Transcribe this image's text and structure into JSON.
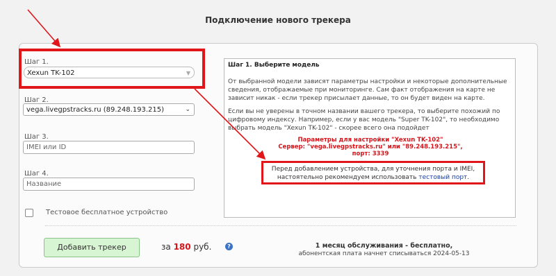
{
  "header": {
    "title": "Подключение нового трекера"
  },
  "form": {
    "step1": {
      "label": "Шаг 1.",
      "value": "Xexun TK-102"
    },
    "step2": {
      "label": "Шаг 2.",
      "value": "vega.livegpstracks.ru (89.248.193.215)"
    },
    "step3": {
      "label": "Шаг 3.",
      "placeholder": "IMEI или ID"
    },
    "step4": {
      "label": "Шаг 4.",
      "placeholder": "Название"
    },
    "test_device_label": "Тестовое бесплатное устройство"
  },
  "info": {
    "title": "Шаг 1. Выберите модель",
    "p1_line1": "От выбранной модели зависят параметры настройки и некоторые дополнительные",
    "p1_line2": "сведения, отображаемые при мониторинге. Сам факт отображения на карте не",
    "p1_line3": "зависит никак - если трекер присылает данные, то он будет виден на карте.",
    "p2_line1": "Если вы не уверены в точном названии вашего трекера, то выберите похожий по",
    "p2_line2": "цифровому индексу. Например, если у вас модель \"Super TK-102\", то необходимо",
    "p2_line3": "выбрать модель \"Xexun TK-102\" - скорее всего она подойдет",
    "params_line1": "Параметры для настройки \"Xexun TK-102\"",
    "params_line2": "Сервер: \"vega.livegpstracks.ru\" или \"89.248.193.215\",",
    "params_line3": "порт: 3339",
    "warn_line1": "Перед добавлением устройства, для уточнения порта и IMEI,",
    "warn_line2": "настоятельно рекомендуем использовать ",
    "warn_link": "тестовый порт",
    "warn_end": "."
  },
  "footer": {
    "add_button": "Добавить трекер",
    "price_prefix": "за",
    "price_value": "180",
    "price_suffix": "руб.",
    "help_icon": "?",
    "service_line1": "1 месяц обслуживания - бесплатно,",
    "service_line2": "абонентская плата начнет списываться 2024-05-13"
  },
  "colors": {
    "annotation_red": "#e0161b",
    "link_blue": "#1a3d9e",
    "button_green": "#d8f5d3"
  }
}
